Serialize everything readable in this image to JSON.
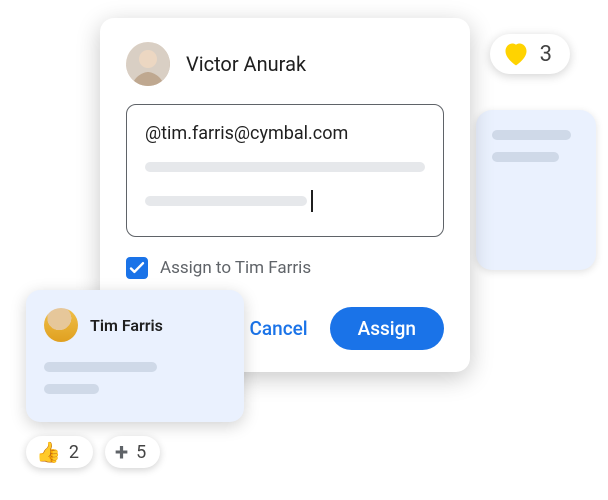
{
  "heart_reaction": {
    "emoji": "💛",
    "count": "3"
  },
  "comment": {
    "author": "Victor Anurak",
    "mention_text": "@tim.farris@cymbal.com",
    "assign_checked": true,
    "assign_label": "Assign to Tim Farris",
    "cancel_label": "Cancel",
    "assign_button_label": "Assign"
  },
  "tim_card": {
    "name": "Tim Farris"
  },
  "reactions": {
    "thumbs": {
      "emoji": "👍",
      "count": "2"
    },
    "plus": {
      "count": "5"
    }
  }
}
